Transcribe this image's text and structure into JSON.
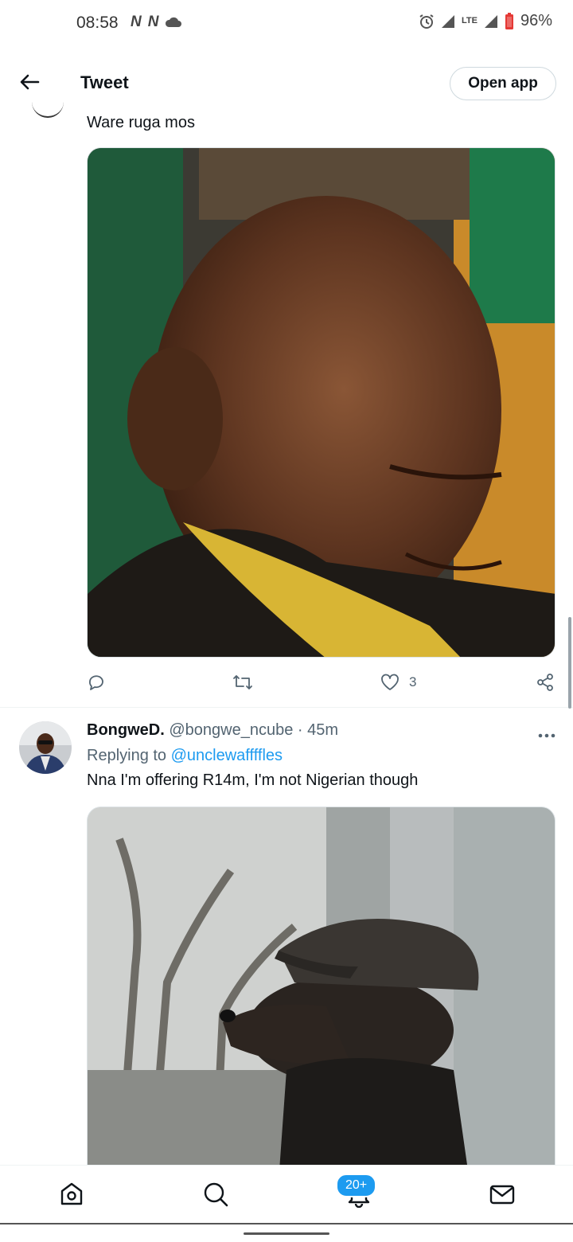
{
  "status_bar": {
    "time": "08:58",
    "left_icons": [
      "N",
      "N"
    ],
    "network": "LTE",
    "battery": "96%"
  },
  "header": {
    "title": "Tweet",
    "open_app_label": "Open app",
    "back_icon": "arrow-left-icon"
  },
  "tweet1": {
    "text": "Ware ruga mos",
    "actions": {
      "reply_count": "",
      "retweet_count": "",
      "like_count": "3"
    }
  },
  "tweet2": {
    "name": "BongweD.",
    "handle": "@bongwe_ncube",
    "time": "45m",
    "separator": "·",
    "replying_prefix": "Replying to",
    "replying_handle": "@unclewaffffles",
    "text": "Nna I'm offering R14m, I'm not Nigerian though"
  },
  "bottom_nav": {
    "items": [
      "home-icon",
      "search-icon",
      "notifications-icon",
      "messages-icon"
    ],
    "notifications_badge": "20+"
  },
  "colors": {
    "accent": "#1d9bf0",
    "text": "#0f1419",
    "secondary": "#536471"
  }
}
